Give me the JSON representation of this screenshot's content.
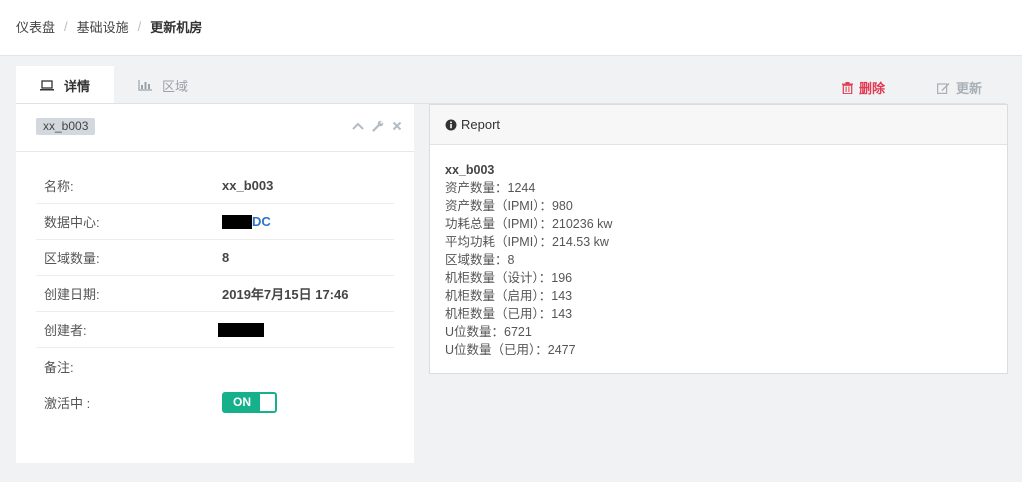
{
  "breadcrumb": {
    "items": [
      "仪表盘",
      "基础设施"
    ],
    "current": "更新机房",
    "separator": "/"
  },
  "tabs": [
    {
      "label": "详情",
      "icon": "laptop-icon",
      "active": true
    },
    {
      "label": "区域",
      "icon": "bar-chart-icon",
      "active": false
    }
  ],
  "actions": {
    "delete": "删除",
    "update": "更新"
  },
  "panel": {
    "tag": "xx_b003",
    "fields": {
      "name_label": "名称:",
      "name_value": "xx_b003",
      "dc_label": "数据中心:",
      "dc_value": "DC",
      "zones_label": "区域数量:",
      "zones_value": "8",
      "created_label": "创建日期:",
      "created_value": "2019年7月15日 17:46",
      "creator_label": "创建者:",
      "remark_label": "备注:",
      "active_label": "激活中 :",
      "active_value": "ON"
    }
  },
  "report": {
    "title": "Report",
    "name": "xx_b003",
    "lines": [
      "资产数量：1244",
      "资产数量（IPMI）：980",
      "功耗总量（IPMI）：210236 kw",
      "平均功耗（IPMI）：214.53 kw",
      "区域数量：8",
      "机柜数量（设计）：196",
      "机柜数量（启用）：143",
      "机柜数量（已用）：143",
      "U位数量：6721",
      "U位数量（已用）：2477"
    ]
  },
  "colors": {
    "accent": "#16b08a",
    "danger": "#e23a52",
    "link": "#2d74c4"
  }
}
